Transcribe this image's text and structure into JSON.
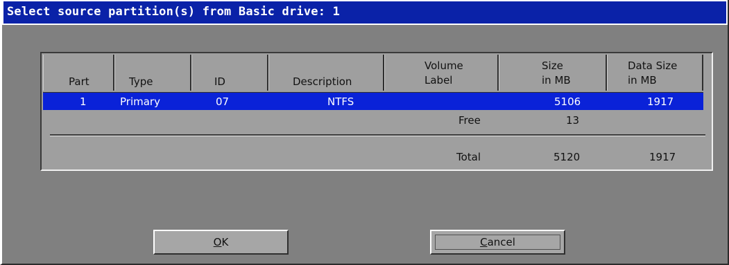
{
  "window": {
    "title": "Select source partition(s) from Basic drive: 1"
  },
  "table": {
    "headers": {
      "part": "Part",
      "type": "Type",
      "id": "ID",
      "description": "Description",
      "volume_label_1": "Volume",
      "volume_label_2": "Label",
      "size_1": "Size",
      "size_2": "in MB",
      "data_size_1": "Data Size",
      "data_size_2": "in MB"
    },
    "rows": [
      {
        "part": "1",
        "type": "Primary",
        "id": "07",
        "description": "NTFS",
        "volume_label": "",
        "size_mb": "5106",
        "data_size_mb": "1917",
        "selected": true
      }
    ],
    "free": {
      "label": "Free",
      "size_mb": "13"
    },
    "total": {
      "label": "Total",
      "size_mb": "5120",
      "data_size_mb": "1917"
    }
  },
  "buttons": {
    "ok": {
      "mnemonic": "O",
      "rest": "K"
    },
    "cancel": {
      "mnemonic": "C",
      "rest": "ancel"
    }
  },
  "colors": {
    "title_bar": "#0a22a8",
    "selection": "#0a22d8",
    "dialog_bg": "#808080",
    "table_bg": "#9f9f9f"
  }
}
